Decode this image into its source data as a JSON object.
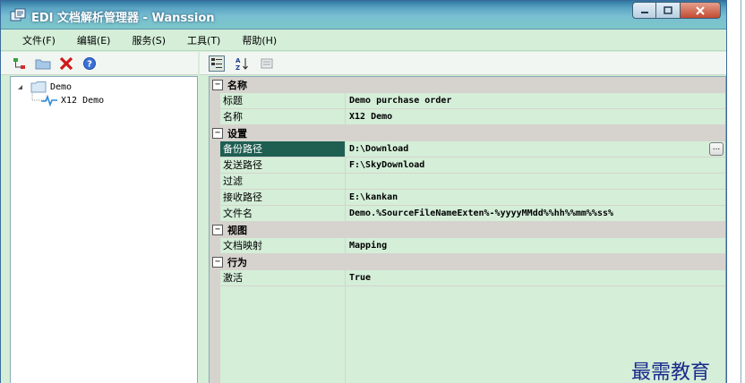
{
  "window": {
    "title": "EDI 文档解析管理器 - Wanssion"
  },
  "menu": [
    "文件(F)",
    "编辑(E)",
    "服务(S)",
    "工具(T)",
    "帮助(H)"
  ],
  "toolbar_left": {
    "icons": [
      "add-node-icon",
      "folder-icon",
      "delete-icon",
      "help-icon"
    ]
  },
  "toolbar_right": {
    "icons": [
      "categorized-view-icon",
      "sort-alpha-icon",
      "property-pages-icon"
    ]
  },
  "tree": {
    "root": "Demo",
    "child": "X12 Demo"
  },
  "properties": {
    "cat1": {
      "label": "名称",
      "rows": [
        {
          "name": "标题",
          "value": "Demo purchase order"
        },
        {
          "name": "名称",
          "value": "X12 Demo"
        }
      ]
    },
    "cat2": {
      "label": "设置",
      "rows": [
        {
          "name": "备份路径",
          "value": "D:\\Download"
        },
        {
          "name": "发送路径",
          "value": "F:\\SkyDownload"
        },
        {
          "name": "过滤",
          "value": ""
        },
        {
          "name": "接收路径",
          "value": "E:\\kankan"
        },
        {
          "name": "文件名",
          "value": "Demo.%SourceFileNameExten%-%yyyyMMdd%%hh%%mm%%ss%"
        }
      ]
    },
    "cat3": {
      "label": "视图",
      "rows": [
        {
          "name": "文档映射",
          "value": "Mapping"
        }
      ]
    },
    "cat4": {
      "label": "行为",
      "rows": [
        {
          "name": "激活",
          "value": "True"
        }
      ]
    }
  },
  "ellipsis_label": "...",
  "toggle_glyph": "⊟",
  "watermark": "最需教育",
  "colors": {
    "panel_green": "#d4eed8",
    "selected": "#1f5f52",
    "category_gray": "#d6d3ce"
  }
}
